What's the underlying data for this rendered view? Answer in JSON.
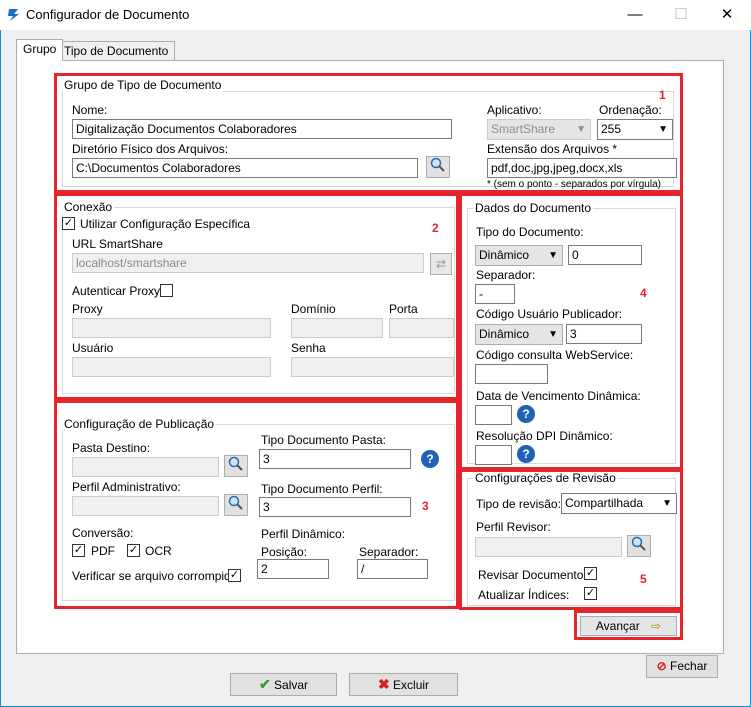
{
  "window": {
    "title": "Configurador de Documento",
    "minimize": "—",
    "maximize": "☐",
    "close": "✕"
  },
  "tabs": [
    "Grupo",
    "Tipo de Documento"
  ],
  "grupo": {
    "legend": "Grupo de Tipo de Documento",
    "marker": "1",
    "nome_label": "Nome:",
    "nome_value": "Digitalização Documentos Colaboradores",
    "dir_label": "Diretório Físico dos Arquivos:",
    "dir_value": "C:\\Documentos Colaboradores",
    "aplicativo_label": "Aplicativo:",
    "aplicativo_value": "SmartShare",
    "ordenacao_label": "Ordenação:",
    "ordenacao_value": "255",
    "extensao_label": "Extensão dos Arquivos *",
    "extensao_value": "pdf,doc,jpg,jpeg,docx,xls",
    "extensao_note": "* (sem o ponto - separados por vírgula)"
  },
  "conexao": {
    "legend": "Conexão",
    "marker": "2",
    "utilizar_label": "Utilizar Configuração Específica",
    "url_label": "URL SmartShare",
    "url_value": "localhost/smartshare",
    "autenticar_label": "Autenticar Proxy:",
    "proxy_label": "Proxy",
    "dominio_label": "Domínio",
    "porta_label": "Porta",
    "usuario_label": "Usuário",
    "senha_label": "Senha"
  },
  "publicacao": {
    "legend": "Configuração de Publicação",
    "marker": "3",
    "pasta_destino_label": "Pasta Destino:",
    "tipo_doc_pasta_label": "Tipo Documento Pasta:",
    "tipo_doc_pasta_value": "3",
    "perfil_admin_label": "Perfil Administrativo:",
    "tipo_doc_perfil_label": "Tipo Documento Perfil:",
    "tipo_doc_perfil_value": "3",
    "conversao_label": "Conversão:",
    "pdf_label": "PDF",
    "ocr_label": "OCR",
    "perfil_dinamico_label": "Perfil Dinâmico:",
    "posicao_label": "Posição:",
    "posicao_value": "2",
    "separador_label": "Separador:",
    "separador_value": "/",
    "verificar_label": "Verificar se arquivo corrompido:"
  },
  "dados": {
    "legend": "Dados do Documento",
    "marker": "4",
    "tipo_doc_label": "Tipo do Documento:",
    "tipo_doc_select": "Dinâmico",
    "tipo_doc_value": "0",
    "separador_label": "Separador:",
    "separador_value": "-",
    "codigo_label": "Código Usuário Publicador:",
    "codigo_select": "Dinâmico",
    "codigo_value": "3",
    "webservice_label": "Código consulta WebService:",
    "vencimento_label": "Data de Vencimento Dinâmica:",
    "resolucao_label": "Resolução DPI Dinâmico:"
  },
  "revisao": {
    "legend": "Configurações de Revisão",
    "marker": "5",
    "tipo_label": "Tipo de revisão:",
    "tipo_value": "Compartilhada",
    "perfil_label": "Perfil Revisor:",
    "revisar_label": "Revisar Documento:",
    "atualizar_label": "Atualizar Índices:"
  },
  "buttons": {
    "avancar": "Avançar",
    "fechar": "Fechar",
    "salvar": "Salvar",
    "excluir": "Excluir"
  },
  "colors": {
    "highlight": "#e5252b",
    "accent": "#1b8ad9",
    "help": "#1f63b6"
  }
}
